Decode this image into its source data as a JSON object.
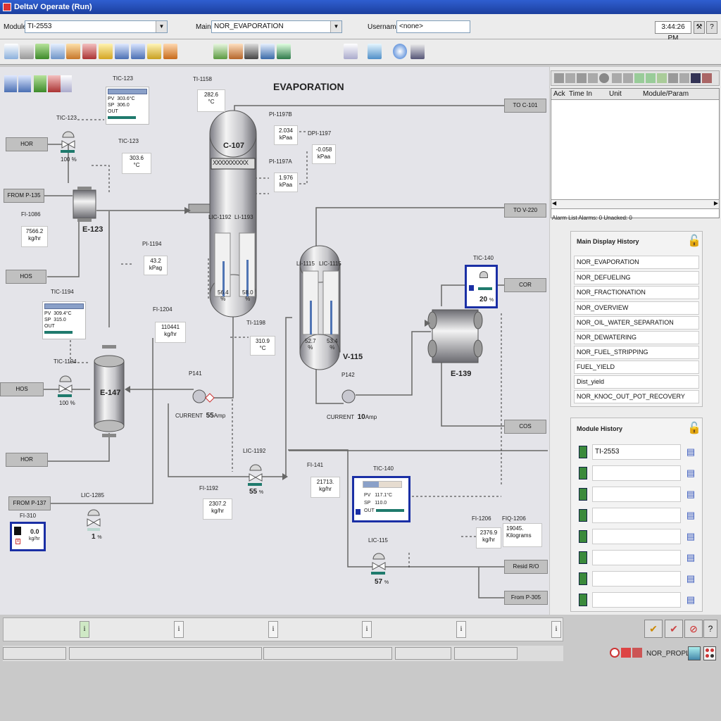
{
  "window": {
    "title": "DeltaV Operate (Run)"
  },
  "topbar": {
    "module_label": "Module",
    "module_value": "TI-2553",
    "main_label": "Main",
    "main_value": "NOR_EVAPORATION",
    "username_label": "Username",
    "username_value": "<none>",
    "clock": "3:44:26 PM"
  },
  "display": {
    "title": "EVAPORATION",
    "equipment": {
      "c107": "C-107",
      "c107_mesh": "XXXXXXXXXX",
      "e123": "E-123",
      "e147": "E-147",
      "v115": "V-115",
      "e139": "E-139",
      "p141": "P141",
      "p142": "P142"
    },
    "tags": {
      "hor1": "HOR",
      "from_p135": "FROM P-135",
      "hos1": "HOS",
      "hos2": "HOS",
      "hor2": "HOR",
      "from_p137": "FROM P-137",
      "to_c101": "TO C-101",
      "to_v220": "TO V-220",
      "cor": "COR",
      "cos": "COS",
      "resid_r0": "Resid R/O",
      "from_p305": "From P-305"
    },
    "ti1158": {
      "tag": "TI-1158",
      "value": "282.6",
      "unit": "°C"
    },
    "pi1197b": {
      "tag": "PI-1197B",
      "value": "2.034",
      "unit": "kPaa"
    },
    "dpi1197": {
      "tag": "DPI-1197",
      "value": "-0.058",
      "unit": "kPaa"
    },
    "pi1197a": {
      "tag": "PI-1197A",
      "value": "1.976",
      "unit": "kPaa"
    },
    "tic123_fp": {
      "tag": "TIC-123",
      "pv_label": "PV",
      "pv": "303.6°C",
      "sp_label": "SP",
      "sp": "306.0",
      "out_label": "OUT"
    },
    "tic123_valve": {
      "tag": "TIC-123",
      "pct": "100",
      "unit": "%"
    },
    "tic123_val": {
      "tag": "TIC-123",
      "value": "303.6",
      "unit": "°C"
    },
    "fi1086": {
      "tag": "FI-1086",
      "value": "7566.2",
      "unit": "kg/hr"
    },
    "pi1194": {
      "tag": "PI-1194",
      "value": "43.2",
      "unit": "kPag"
    },
    "lic1192_lvl": {
      "tag": "LIC-1192",
      "value": "56.4",
      "unit": "%",
      "level": 0.56
    },
    "li1193_lvl": {
      "tag": "LI-1193",
      "value": "58.0",
      "unit": "%",
      "level": 0.58
    },
    "tic1194_fp": {
      "tag": "TIC-1194",
      "pv_label": "PV",
      "pv": "309.4°C",
      "sp_label": "SP",
      "sp": "315.0",
      "out_label": "OUT"
    },
    "fi1204": {
      "tag": "FI-1204",
      "value": "110441",
      "unit": "kg/hr"
    },
    "ti1198": {
      "tag": "TI-1198",
      "value": "310.9",
      "unit": "°C"
    },
    "tic1194_valve": {
      "tag": "TIC-1194",
      "pct": "100",
      "unit": "%"
    },
    "p141": {
      "current_label": "CURRENT",
      "current": "55",
      "unit": "Amp"
    },
    "li1115": {
      "tag": "LI-1115",
      "value": "52.7",
      "unit": "%",
      "level": 0.53
    },
    "lic1115": {
      "tag": "LIC-1115",
      "value": "53.4",
      "unit": "%",
      "level": 0.53
    },
    "p142": {
      "current_label": "CURRENT",
      "current": "10",
      "unit": "Amp"
    },
    "tic140_sel": {
      "tag": "TIC-140",
      "pct": "20",
      "unit": "%"
    },
    "lic1192_valve": {
      "tag": "LIC-1192",
      "pct": "55",
      "unit": "%"
    },
    "fi1192": {
      "tag": "FI-1192",
      "value": "2307.2",
      "unit": "kg/hr"
    },
    "fi141": {
      "tag": "FI-141",
      "value": "21713.",
      "unit": "kg/hr"
    },
    "tic140_fp": {
      "tag": "TIC-140",
      "pv_label": "PV",
      "pv": "117.1°C",
      "sp_label": "SP",
      "sp": "110.0",
      "out_label": "OUT"
    },
    "lic1285": {
      "tag": "LIC-1285",
      "pct": "1",
      "unit": "%"
    },
    "fi310": {
      "tag": "FI-310",
      "value": "0.0",
      "unit": "kg/hr"
    },
    "fi1206": {
      "tag": "FI-1206",
      "value": "2376.9",
      "unit": "kg/hr"
    },
    "fiq1206": {
      "tag": "FIQ-1206",
      "value": "19045.",
      "unit": "Kilograms"
    },
    "lic115": {
      "tag": "LIC-115",
      "pct": "57",
      "unit": "%"
    }
  },
  "alarm_list": {
    "col_ack": "Ack",
    "col_time": "Time In",
    "col_unit": "Unit",
    "col_module": "Module/Param",
    "status": "Alarm List  Alarms: 0  Unacked: 0"
  },
  "main_history": {
    "title": "Main Display History",
    "items": [
      "NOR_EVAPORATION",
      "NOR_DEFUELING",
      "NOR_FRACTIONATION",
      "NOR_OVERVIEW",
      "NOR_OIL_WATER_SEPARATION",
      "NOR_DEWATERING",
      "NOR_FUEL_STRIPPING",
      "FUEL_YIELD",
      "Dist_yield",
      "NOR_KNOC_OUT_POT_RECOVERY"
    ]
  },
  "module_history": {
    "title": "Module History",
    "items": [
      "TI-2553",
      "",
      "",
      "",
      "",
      "",
      "",
      ""
    ]
  },
  "statusbar": {
    "i_label": "i",
    "node": "NOR_PROPLU"
  },
  "colors": {
    "accent_select": "#1a2fa5",
    "titlebar": "#2f5fd0",
    "output_bar": "#1f7a6d"
  }
}
